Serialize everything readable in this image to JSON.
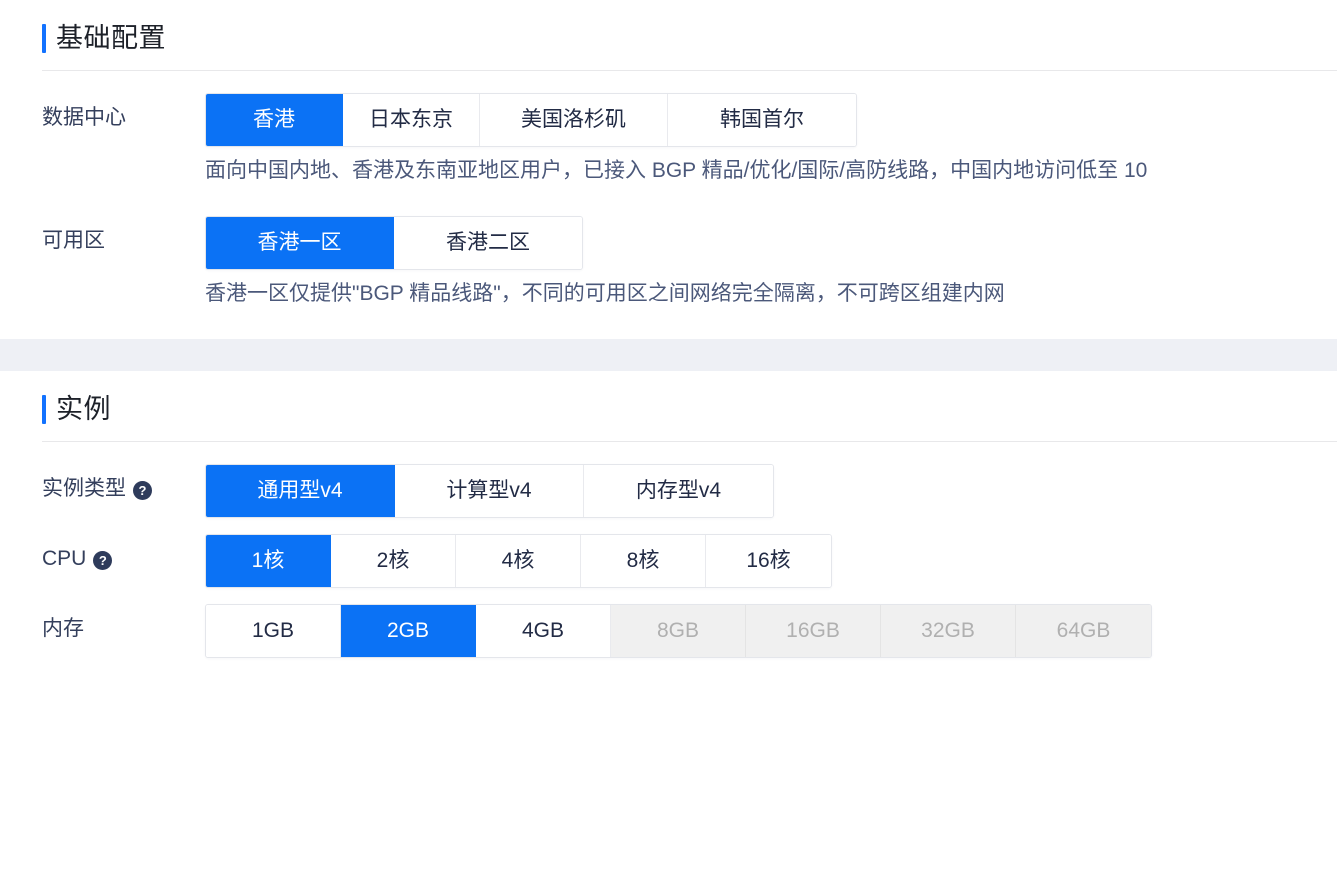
{
  "sections": [
    {
      "id": "basic",
      "title": "基础配置",
      "rows": [
        {
          "id": "datacenter",
          "label": "数据中心",
          "help": false,
          "options": [
            {
              "label": "香港",
              "state": "selected"
            },
            {
              "label": "日本东京",
              "state": "normal"
            },
            {
              "label": "美国洛杉矶",
              "state": "normal",
              "wide": true
            },
            {
              "label": "韩国首尔",
              "state": "normal",
              "wide": true
            }
          ],
          "hint": "面向中国内地、香港及东南亚地区用户，已接入 BGP 精品/优化/国际/高防线路，中国内地访问低至 10"
        },
        {
          "id": "availability-zone",
          "label": "可用区",
          "help": false,
          "options": [
            {
              "label": "香港一区",
              "state": "selected"
            },
            {
              "label": "香港二区",
              "state": "normal"
            }
          ],
          "hint": "香港一区仅提供\"BGP 精品线路\"，不同的可用区之间网络完全隔离，不可跨区组建内网"
        }
      ]
    },
    {
      "id": "instance",
      "title": "实例",
      "rows": [
        {
          "id": "instance-type",
          "label": "实例类型",
          "help": true,
          "options": [
            {
              "label": "通用型v4",
              "state": "selected"
            },
            {
              "label": "计算型v4",
              "state": "normal"
            },
            {
              "label": "内存型v4",
              "state": "normal"
            }
          ],
          "hint": ""
        },
        {
          "id": "cpu",
          "label": "CPU",
          "help": true,
          "options": [
            {
              "label": "1核",
              "state": "selected"
            },
            {
              "label": "2核",
              "state": "normal"
            },
            {
              "label": "4核",
              "state": "normal"
            },
            {
              "label": "8核",
              "state": "normal"
            },
            {
              "label": "16核",
              "state": "normal"
            }
          ],
          "hint": ""
        },
        {
          "id": "memory",
          "label": "内存",
          "help": false,
          "options": [
            {
              "label": "1GB",
              "state": "normal"
            },
            {
              "label": "2GB",
              "state": "selected"
            },
            {
              "label": "4GB",
              "state": "normal"
            },
            {
              "label": "8GB",
              "state": "disabled"
            },
            {
              "label": "16GB",
              "state": "disabled"
            },
            {
              "label": "32GB",
              "state": "disabled"
            },
            {
              "label": "64GB",
              "state": "disabled"
            }
          ],
          "hint": ""
        }
      ]
    }
  ],
  "icons": {
    "help": "?"
  },
  "colors": {
    "accent": "#0b72f5",
    "title_bar": "#1272ff",
    "label_text": "#343f5c",
    "hint_text": "#4b587a",
    "band": "#eef0f5",
    "disabled_bg": "#f0f0f0",
    "disabled_text": "#b0b0b0",
    "help_icon_bg": "#2e3b5b"
  }
}
